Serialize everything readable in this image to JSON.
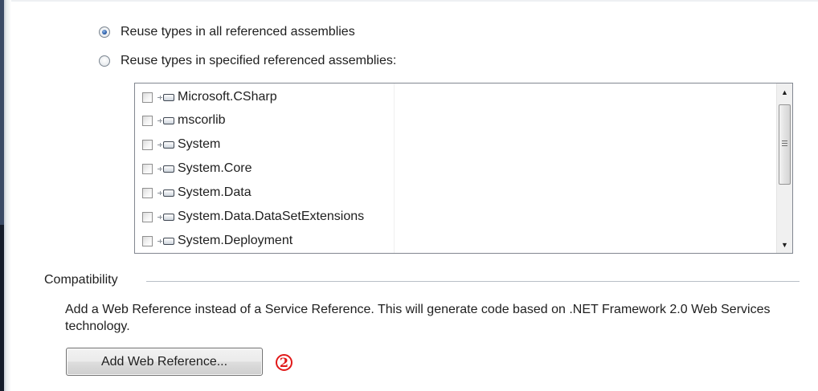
{
  "reuse_options": {
    "all_label": "Reuse types in all referenced assemblies",
    "all_selected": true,
    "specified_label": "Reuse types in specified referenced assemblies:",
    "specified_selected": false
  },
  "assemblies": [
    {
      "name": "Microsoft.CSharp",
      "checked": false,
      "icon": "assembly-icon"
    },
    {
      "name": "mscorlib",
      "checked": false,
      "icon": "assembly-icon"
    },
    {
      "name": "System",
      "checked": false,
      "icon": "assembly-icon"
    },
    {
      "name": "System.Core",
      "checked": false,
      "icon": "assembly-icon"
    },
    {
      "name": "System.Data",
      "checked": false,
      "icon": "assembly-icon"
    },
    {
      "name": "System.Data.DataSetExtensions",
      "checked": false,
      "icon": "assembly-icon"
    },
    {
      "name": "System.Deployment",
      "checked": false,
      "icon": "assembly-icon"
    }
  ],
  "compatibility": {
    "title": "Compatibility",
    "description": "Add a Web Reference instead of a Service Reference. This will generate code based on .NET Framework 2.0 Web Services technology.",
    "button_label": "Add Web Reference..."
  },
  "annotation": {
    "label": "2",
    "color": "#e11919"
  },
  "colors": {
    "radio_selected": "#2c5ea8",
    "border": "#828790",
    "window_edge": "#3a4a66"
  }
}
